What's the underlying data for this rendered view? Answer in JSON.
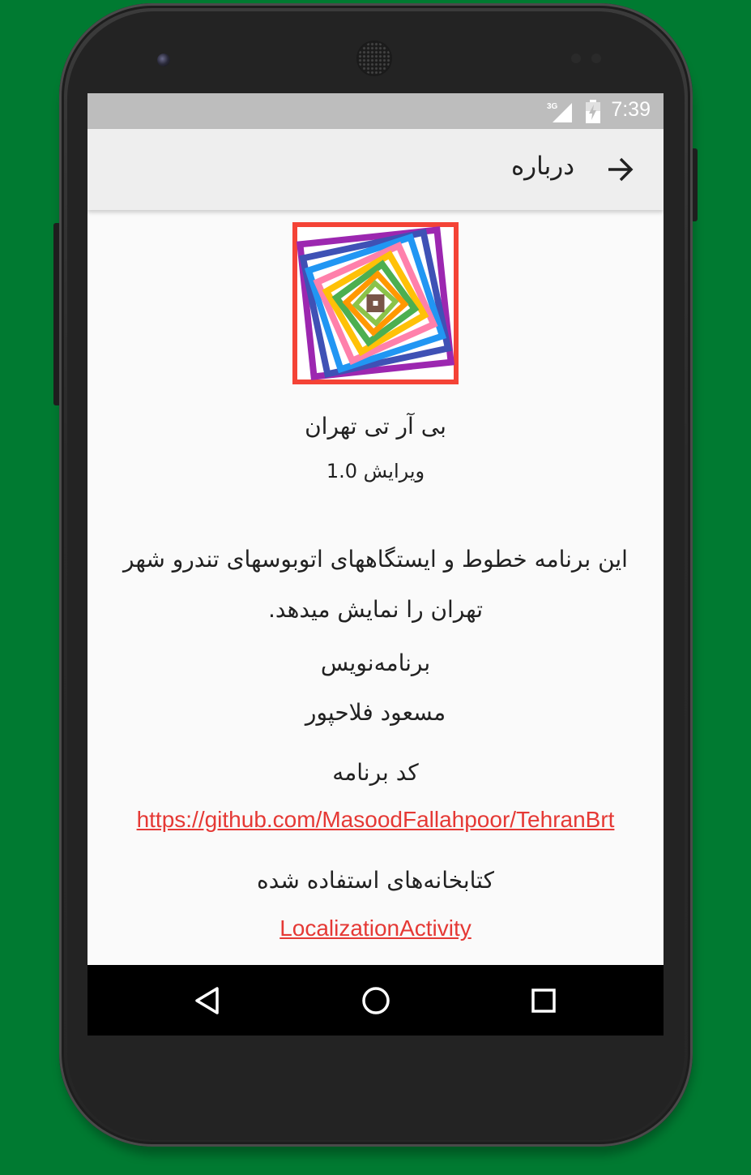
{
  "status_bar": {
    "time": "7:39",
    "network": "3G"
  },
  "toolbar": {
    "title": "درباره"
  },
  "about": {
    "app_name": "بی آر تی تهران",
    "version": "ویرایش 1.0",
    "description": "این برنامه خطوط و ایستگاههای اتوبوسهای تندرو شهر تهران را نمایش میدهد.",
    "developer_heading": "برنامه‌نویس",
    "developer_name": "مسعود فلاحپور",
    "source_heading": "کد برنامه",
    "source_link": "https://github.com/MasoodFallahpoor/TehranBrt",
    "libraries_heading": "کتابخانه‌های استفاده شده",
    "library_link": "LocalizationActivity"
  },
  "colors": {
    "background": "#007a31",
    "toolbar": "#eeeeee",
    "status_bar": "#bdbdbd",
    "link": "#e53935",
    "nav_bar": "#000000"
  },
  "icons": {
    "back": "arrow-right-icon",
    "nav_back": "triangle-back-icon",
    "nav_home": "circle-home-icon",
    "nav_recents": "square-recents-icon"
  },
  "logo_colors": [
    "#f44336",
    "#9c27b0",
    "#3f51b5",
    "#2196f3",
    "#ff80ab",
    "#ffc107",
    "#4caf50",
    "#ff9800",
    "#8bc34a",
    "#795548"
  ]
}
